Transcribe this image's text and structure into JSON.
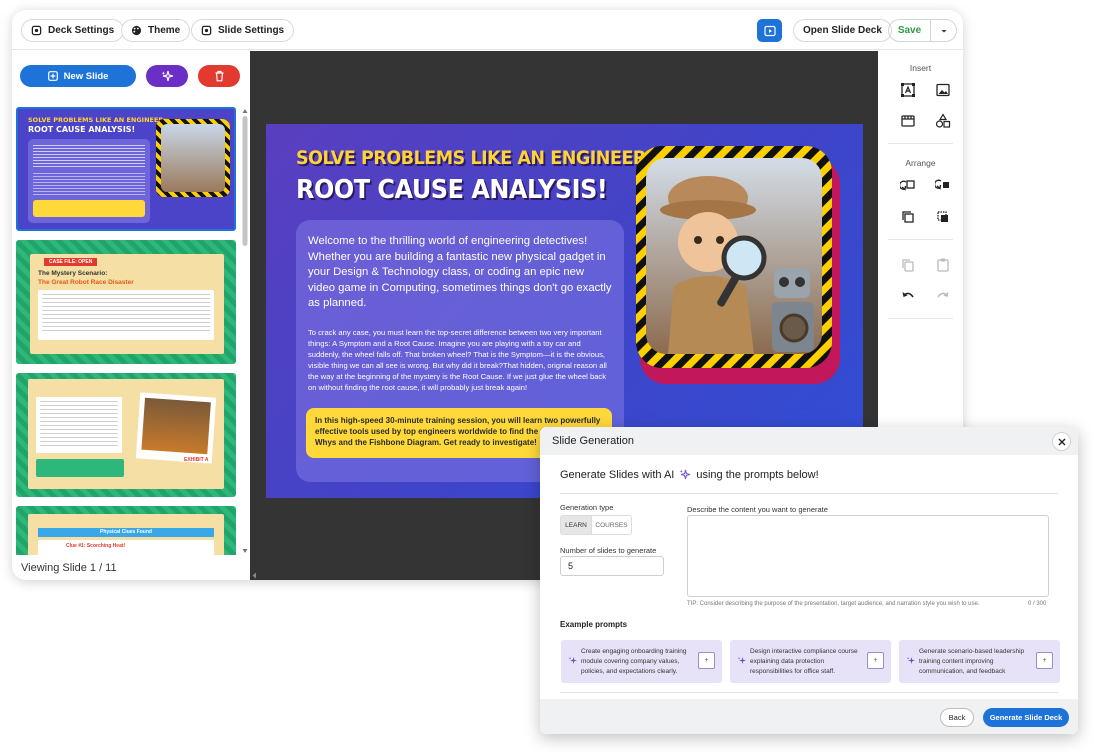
{
  "toolbar": {
    "deck_settings": "Deck Settings",
    "theme": "Theme",
    "slide_settings": "Slide Settings",
    "open_slide_deck": "Open Slide Deck",
    "save": "Save"
  },
  "left_panel": {
    "new_slide": "New Slide",
    "viewing": "Viewing Slide 1 / 11",
    "thumbnails": [
      {
        "title_line1": "SOLVE PROBLEMS LIKE AN ENGINEER:",
        "title_line2": "ROOT CAUSE ANALYSIS!"
      },
      {
        "tag": "CASE FILE: OPEN",
        "title_line1": "The Mystery Scenario:",
        "title_line2": "The Great Robot Race Disaster"
      },
      {
        "caption": "EXHIBIT A"
      },
      {
        "header": "Physical Clues Found",
        "item": "Clue #1: Scorching Heat!"
      }
    ]
  },
  "slide": {
    "title_line1": "SOLVE PROBLEMS LIKE AN ENGINEER:",
    "title_line2": "ROOT CAUSE ANALYSIS!",
    "intro": "Welcome to the thrilling world of engineering detectives! Whether you are building a fantastic new physical gadget in your Design & Technology class, or coding an epic new video game in Computing, sometimes things don't go exactly as planned.",
    "body": "To crack any case, you must learn the top-secret difference between two very important things: A Symptom and a Root Cause. Imagine you are playing with a toy car and suddenly, the wheel falls off. That broken wheel? That is the Symptom—it is the obvious, visible thing we can all see is wrong. But why did it break?That hidden, original reason all the way at the beginning of the mystery is the Root Cause. If we just glue the wheel back on without finding the root cause, it will probably just break again!",
    "highlight": "In this high-speed 30-minute training session, you will learn two powerfully effective tools used by top engineers worldwide to find the truth: The 5 Whys and the Fishbone Diagram. Get ready to investigate!"
  },
  "right_panel": {
    "insert": "Insert",
    "arrange": "Arrange"
  },
  "dialog": {
    "title": "Slide Generation",
    "heading_prefix": "Generate Slides with AI",
    "heading_suffix": "using the prompts below!",
    "generation_type_label": "Generation type",
    "type_options": [
      "LEARN",
      "COURSES"
    ],
    "num_slides_label": "Number of slides to generate",
    "num_slides_value": "5",
    "describe_label": "Describe the content you want to generate",
    "tip": "TIP: Consider describing the purpose of the presentation, target audience, and narration style you wish to use.",
    "counter": "0 / 300",
    "example_label": "Example prompts",
    "examples": [
      "Create engaging onboarding training module covering company values, policies, and expectations clearly.",
      "Design interactive compliance course explaining data protection responsibilities for office staff.",
      "Generate scenario-based leadership training content improving communication, and feedback"
    ],
    "plus": "+",
    "back": "Back",
    "generate": "Generate Slide Deck"
  },
  "colors": {
    "primary": "#1e73d8",
    "magic": "#6b2fc5",
    "danger": "#e23a2e",
    "save_green": "#2e9a44",
    "highlight_yellow": "#ffd93a",
    "slide_purple": "#4a40c4"
  }
}
